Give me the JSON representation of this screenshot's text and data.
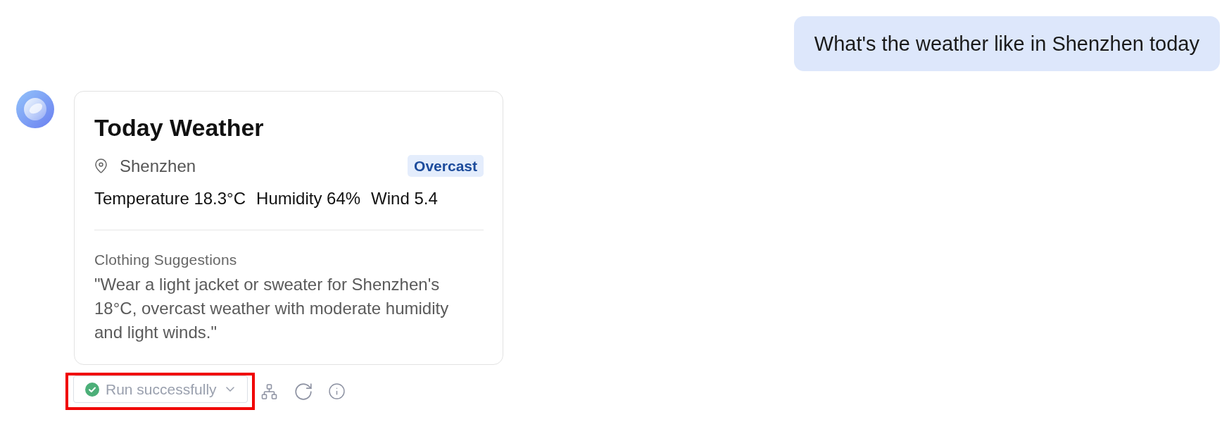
{
  "user_message": {
    "text": "What's the weather like in Shenzhen today"
  },
  "weather_card": {
    "title": "Today Weather",
    "location": "Shenzhen",
    "condition": "Overcast",
    "stats": [
      "Temperature 18.3°C",
      "Humidity 64%",
      "Wind 5.4"
    ],
    "section_label": "Clothing Suggestions",
    "suggestion": "\"Wear a light jacket or sweater for Shenzhen's 18°C, overcast weather with moderate humidity and light winds.\""
  },
  "run_status": {
    "label": "Run successfully",
    "kind": "success",
    "highlighted": true
  }
}
